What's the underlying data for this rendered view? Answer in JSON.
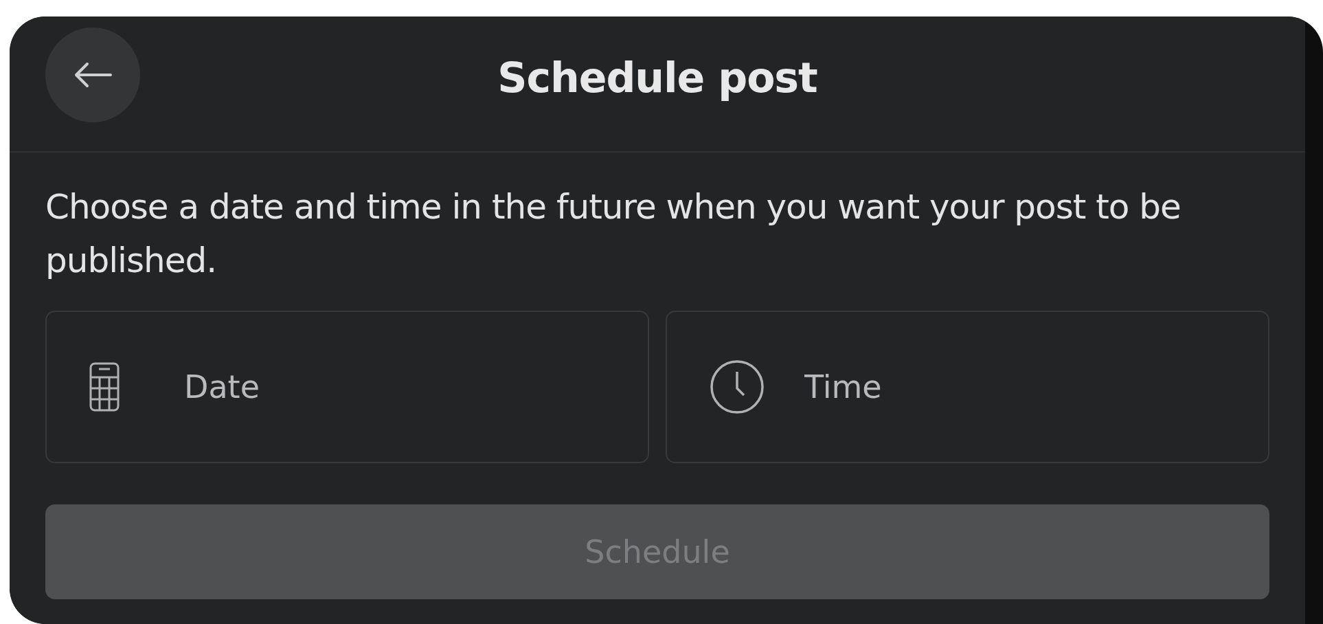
{
  "header": {
    "title": "Schedule post"
  },
  "description": "Choose a date and time in the future when you want your post to be published.",
  "fields": [
    {
      "kind": "date",
      "placeholder": "Date"
    },
    {
      "kind": "time",
      "placeholder": "Time"
    }
  ],
  "submit": {
    "label": "Schedule",
    "disabled": true
  }
}
